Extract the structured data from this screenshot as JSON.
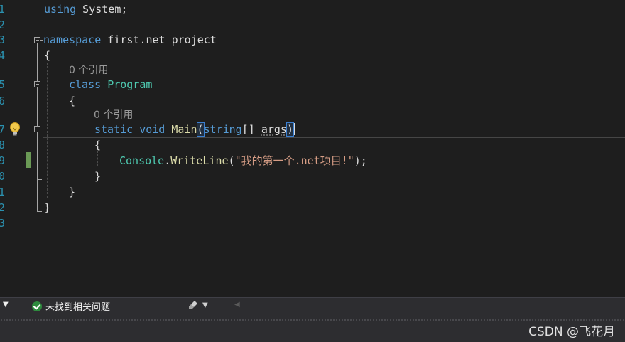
{
  "editor": {
    "line_numbers": [
      "1",
      "2",
      "3",
      "4",
      "",
      "5",
      "6",
      "",
      "7",
      "8",
      "9",
      "0",
      "1",
      "2",
      "3"
    ],
    "code": {
      "using_kw": "using",
      "using_rest": " System;",
      "ns_kw": "namespace",
      "ns_name": " first.net_project",
      "open_brace_0": "{",
      "lens_program": "0 个引用",
      "class_kw": "class",
      "class_name": "Program",
      "open_brace_1": "{",
      "lens_main": "0 个引用",
      "static_kw": "static",
      "void_kw": "void",
      "main_name": "Main",
      "paren_open": "(",
      "string_kw": "string",
      "brackets": "[]",
      "args_name": "args",
      "paren_close": ")",
      "open_brace_2": "{",
      "console_type": "Console",
      "dot": ".",
      "writeline": "WriteLine",
      "call_open": "(",
      "string_literal": "\"我的第一个.net项目!\"",
      "call_close": ");",
      "close_brace_2": "}",
      "close_brace_1": "}",
      "close_brace_0": "}"
    },
    "quick_action_icon": "lightbulb-icon",
    "colors": {
      "keyword": "#569cd6",
      "type": "#4ec9b0",
      "method": "#dcdcaa",
      "string": "#d69d85",
      "line_number": "#2b91af",
      "change_bar": "#6a9955"
    }
  },
  "statusbar": {
    "dropdown_icon": "triangle-down-icon",
    "issues_icon": "check-circle-icon",
    "issues_label": "未找到相关问题",
    "cleanup_icon": "brush-icon"
  },
  "watermark": "CSDN @飞花月"
}
